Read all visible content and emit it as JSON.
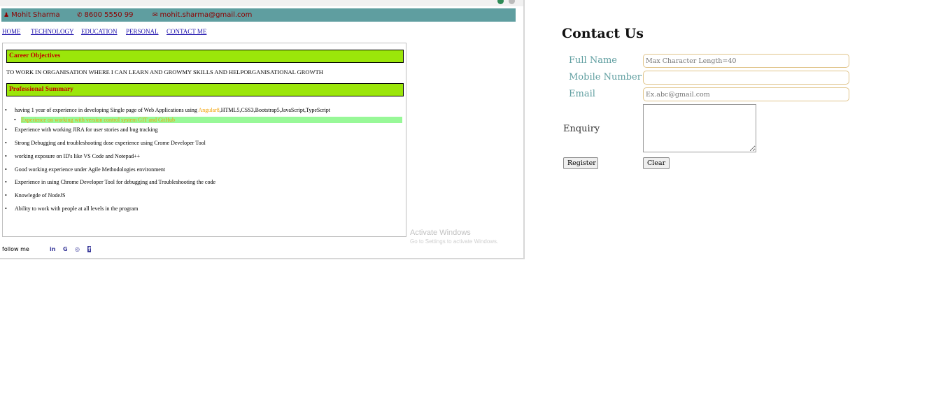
{
  "header": {
    "name": "Mohit Sharma",
    "phone": "8600 5550 99",
    "email": "mohit.sharma@gmail.com"
  },
  "nav": [
    "HOME",
    "TECHNOLOGY",
    "EDUCATION",
    "PERSONAL",
    "CONTACT ME"
  ],
  "career": {
    "heading": "Career Objectives",
    "text": "TO WORK IN ORGANISATION WHERE I CAN LEARN AND GROWMY SKILLS AND HELPORGANISATIONAL GROWTH"
  },
  "summary": {
    "heading": "Professional Summary",
    "item0_pre": "having 1 year of experience in developing Single page of Web Applications using ",
    "item0_highlight": "Angular8",
    "item0_post": ",HTML5,CSS3,Bootstrap5,JavaScript,TypeScript",
    "items": [
      "Experience on working with version control system  GIT and GitHub",
      "Experience with working JIRA for user stories and bug tracking",
      "Strong Debugging and troubleshooting dose experience using Crome Developer Tool",
      "working exposure on ID's like VS Code and Notepad++",
      "Good working experience under Agile Methodologies environment",
      "Experience in using Chrome Developer Tool for debugging and Troubleshooting the code",
      "Knowlegde of NodeJS",
      "Ability to work with people at all levels in the program"
    ]
  },
  "watermark": {
    "line1": "Activate Windows",
    "line2": "Go to Settings to activate Windows."
  },
  "footer": {
    "follow": "follow me",
    "social": [
      "in",
      "G",
      "◎",
      "f"
    ]
  },
  "contact": {
    "title": "Contact Us",
    "full_name_label": "Full Name",
    "full_name_placeholder": "Max Character Length=40",
    "mobile_label": "Mobile Number",
    "mobile_placeholder": "",
    "email_label": "Email",
    "email_placeholder": "Ex.abc@gmail.com",
    "enquiry_label": "Enquiry",
    "register_label": "Register",
    "clear_label": "Clear"
  },
  "colors": {
    "header_bg": "#5f9ea0",
    "header_text": "#8b0000",
    "section_bg": "#9be60a",
    "section_text": "#c10000",
    "highlight_row": "#98f898",
    "accent_orange": "#f2a000",
    "label_teal": "#5f9ea0",
    "input_border": "#e0c48a"
  },
  "icons": [
    "user-icon",
    "phone-icon",
    "envelope-icon",
    "linkedin-icon",
    "google-icon",
    "instagram-icon",
    "facebook-icon"
  ]
}
